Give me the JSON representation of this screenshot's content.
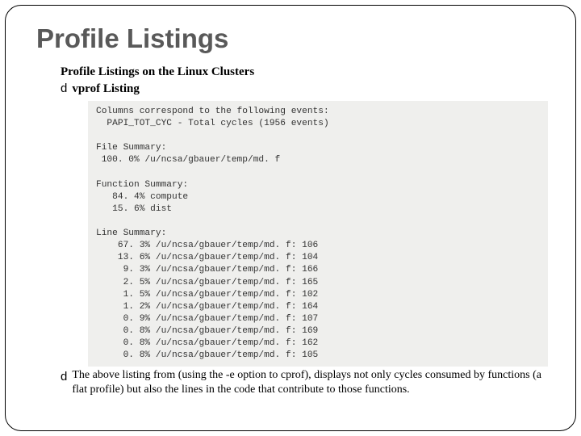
{
  "title": "Profile Listings",
  "subtitle": "Profile Listings on the Linux Clusters",
  "bullet1": "vprof Listing",
  "code": {
    "l01": "Columns correspond to the following events:",
    "l02": "  PAPI_TOT_CYC - Total cycles (1956 events)",
    "l03": "",
    "l04": "File Summary:",
    "l05": " 100. 0% /u/ncsa/gbauer/temp/md. f",
    "l06": "",
    "l07": "Function Summary:",
    "l08": "   84. 4% compute",
    "l09": "   15. 6% dist",
    "l10": "",
    "l11": "Line Summary:",
    "l12": "    67. 3% /u/ncsa/gbauer/temp/md. f: 106",
    "l13": "    13. 6% /u/ncsa/gbauer/temp/md. f: 104",
    "l14": "     9. 3% /u/ncsa/gbauer/temp/md. f: 166",
    "l15": "     2. 5% /u/ncsa/gbauer/temp/md. f: 165",
    "l16": "     1. 5% /u/ncsa/gbauer/temp/md. f: 102",
    "l17": "     1. 2% /u/ncsa/gbauer/temp/md. f: 164",
    "l18": "     0. 9% /u/ncsa/gbauer/temp/md. f: 107",
    "l19": "     0. 8% /u/ncsa/gbauer/temp/md. f: 169",
    "l20": "     0. 8% /u/ncsa/gbauer/temp/md. f: 162",
    "l21": "     0. 8% /u/ncsa/gbauer/temp/md. f: 105"
  },
  "footnote": "The above listing from (using the -e option to cprof), displays not only cycles consumed by functions (a flat profile) but also the lines in the code that contribute to those functions.",
  "bullet_glyph": "d"
}
